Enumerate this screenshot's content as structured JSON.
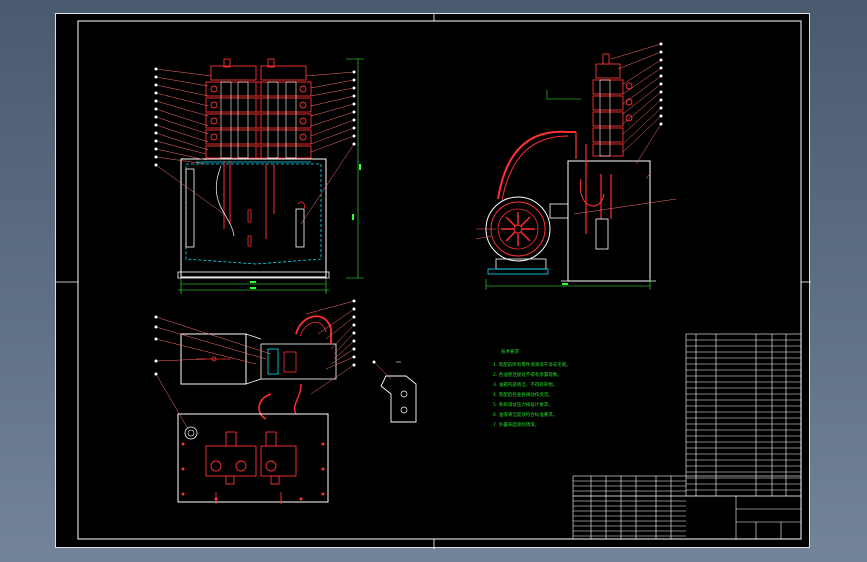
{
  "tech_notes": {
    "title": "技术要求",
    "lines": [
      "1. 装配前所有零件须清洗干净去毛刺。",
      "2. 各油管连接处不得有渗漏现象。",
      "3. 油箱内部清洁，不得有杂物。",
      "4. 装配后检查各阀动作灵活。",
      "5. 系统调试压力按设计要求。",
      "6. 油液清洁度须符合标准要求。",
      "7. 外露表面涂防锈漆。"
    ]
  },
  "colors": {
    "background": "#000000",
    "line": "#ffffff",
    "component": "#ff3030",
    "hidden": "#00e5ff",
    "dimension": "#30ff30",
    "leader": "#ff7070",
    "outer_frame": "#4d5e74"
  }
}
